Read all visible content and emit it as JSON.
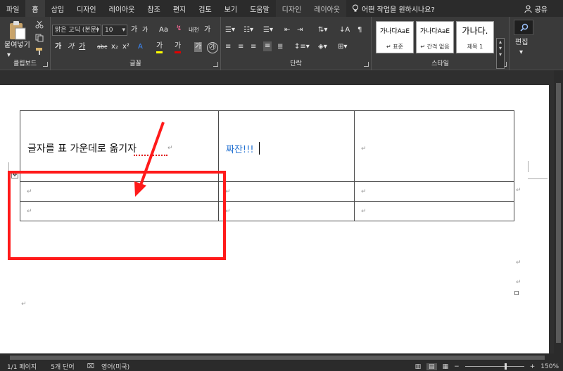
{
  "tabs": [
    "파일",
    "홈",
    "삽입",
    "디자인",
    "레이아웃",
    "참조",
    "편지",
    "검토",
    "보기",
    "도움말",
    "디자인",
    "레이아웃"
  ],
  "active_tab_index": 1,
  "tell_me": "어떤 작업을 원하시나요?",
  "share": "공유",
  "clipboard": {
    "paste": "붙여넣기",
    "label": "클립보드"
  },
  "font": {
    "family": "맑은 고딕 (본문)",
    "size": "10",
    "label": "글꼴",
    "size_up": "가",
    "size_down": "가",
    "case": "Aa",
    "bold": "가",
    "italic": "가",
    "underline": "가",
    "strike": "abc",
    "subscript": "x₂",
    "superscript": "x²",
    "highlight": "가",
    "color": "가",
    "char_shade": "가",
    "enclose": "가"
  },
  "paragraph": {
    "label": "단락"
  },
  "styles": {
    "label": "스타일",
    "items": [
      {
        "preview": "가나다AaE",
        "name": "↵ 표준"
      },
      {
        "preview": "가나다AaE",
        "name": "↵ 간격 없음"
      },
      {
        "preview": "가나다.",
        "name": "제목 1"
      }
    ]
  },
  "editing": {
    "label": "편집"
  },
  "document": {
    "cell_main": "글자를 표 가운데로 옮기자",
    "cell_blue": "짜잔!!!",
    "pilcrow": "↵"
  },
  "status": {
    "page": "1/1 페이지",
    "words": "5개 단어",
    "lang": "영어(미국)",
    "zoom": "150%"
  },
  "colors": {
    "annotation": "#ff1a1a",
    "blue_text": "#1f6fd1",
    "ribbon": "#3a3a3a",
    "tabbar": "#2b2b2b"
  }
}
